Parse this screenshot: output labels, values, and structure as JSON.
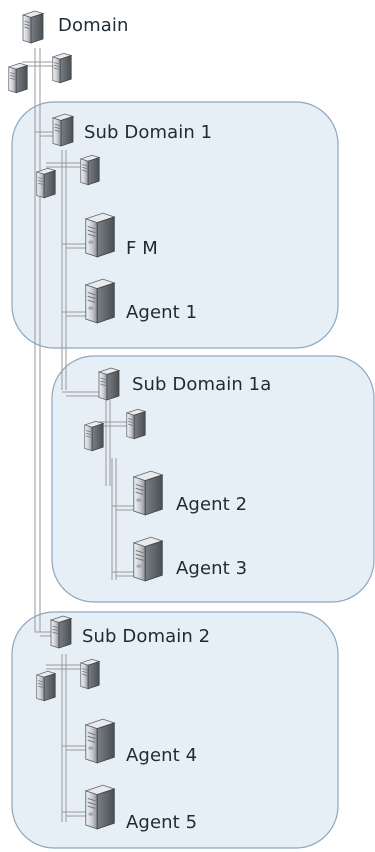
{
  "diagram": {
    "root_label": "Domain",
    "groups": [
      {
        "name": "sub-domain-1",
        "label": "Sub Domain 1",
        "members": [
          "F M",
          "Agent 1"
        ]
      },
      {
        "name": "sub-domain-1a",
        "label": "Sub Domain 1a",
        "members": [
          "Agent 2",
          "Agent 3"
        ]
      },
      {
        "name": "sub-domain-2",
        "label": "Sub Domain 2",
        "members": [
          "Agent 4",
          "Agent 5"
        ]
      }
    ],
    "colors": {
      "group_fill": "#e6eef6",
      "group_stroke": "#8ea6bd",
      "line": "#9a9a9a",
      "server_body": "#c9ccd0",
      "server_dark": "#5e6368",
      "text": "#1f2a33"
    },
    "icons": {
      "server": "server-tower-icon",
      "cluster": "server-pair-icon"
    }
  }
}
